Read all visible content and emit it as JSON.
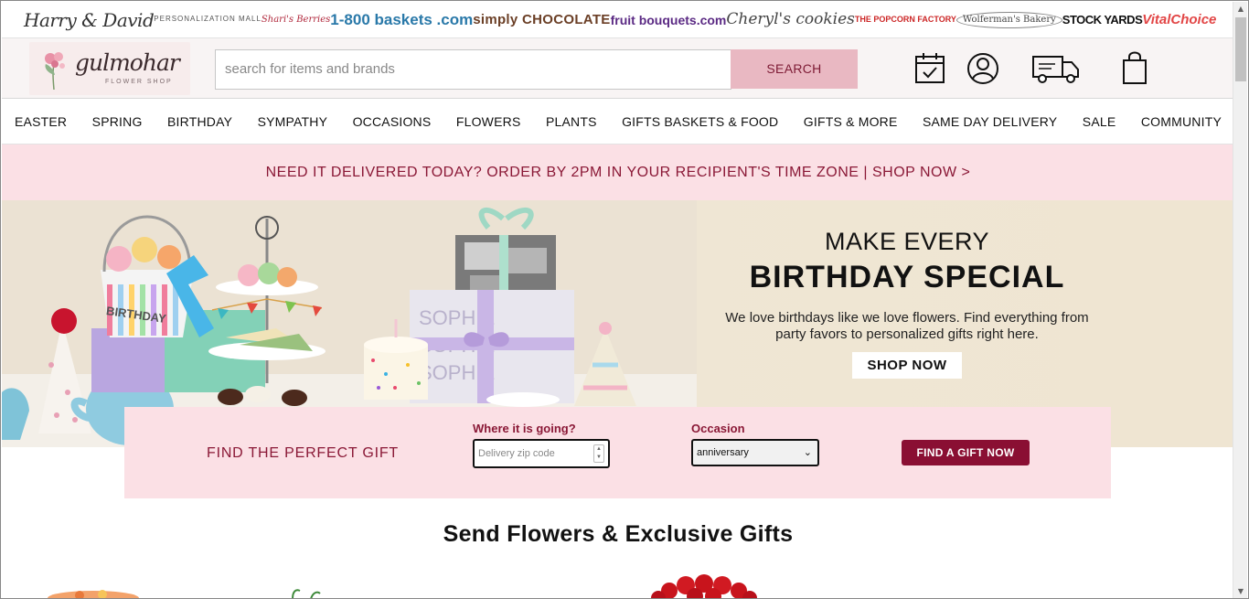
{
  "brands": [
    "Harry & David",
    "PERSONALIZATION MALL",
    "Shari's Berries",
    "1-800 baskets .com",
    "simply CHOCOLATE",
    "fruit bouquets.com",
    "Cheryl's cookies",
    "THE POPCORN FACTORY",
    "Wolferman's Bakery",
    "STOCK YARDS",
    "VitalChoice"
  ],
  "header": {
    "logo": {
      "script": "gulmohar",
      "subtitle": "FLOWER SHOP"
    },
    "search_placeholder": "search for items and brands",
    "search_button": "SEARCH",
    "icons": [
      "calendar-icon",
      "account-icon",
      "delivery-truck-icon",
      "shopping-bag-icon"
    ]
  },
  "nav": [
    "EASTER",
    "SPRING",
    "BIRTHDAY",
    "SYMPATHY",
    "OCCASIONS",
    "FLOWERS",
    "PLANTS",
    "GIFTS BASKETS & FOOD",
    "GIFTS & MORE",
    "SAME DAY DELIVERY",
    "SALE",
    "COMMUNITY"
  ],
  "promo": "NEED IT DELIVERED TODAY? ORDER BY 2PM IN YOUR RECIPIENT'S TIME ZONE | SHOP NOW >",
  "hero": {
    "kicker": "MAKE EVERY",
    "title": "BIRTHDAY SPECIAL",
    "desc_line1": "We love birthdays like we love flowers. Find everything from",
    "desc_line2": "party favors to personalized gifts right here.",
    "cta": "SHOP NOW",
    "image_text": [
      "BIRTHDAY",
      "SOPHIE"
    ]
  },
  "finder": {
    "title": "FIND THE PERFECT GIFT",
    "where_label": "Where it is going?",
    "zip_placeholder": "Delivery zip code",
    "occasion_label": "Occasion",
    "occasion_value": "anniversary",
    "button": "FIND A GIFT NOW"
  },
  "section_title": "Send Flowers & Exclusive Gifts",
  "colors": {
    "accent": "#8a1836",
    "promo_bg": "#fbe0e5",
    "button": "#8a0f33",
    "search_btn": "#e9b8c2"
  }
}
